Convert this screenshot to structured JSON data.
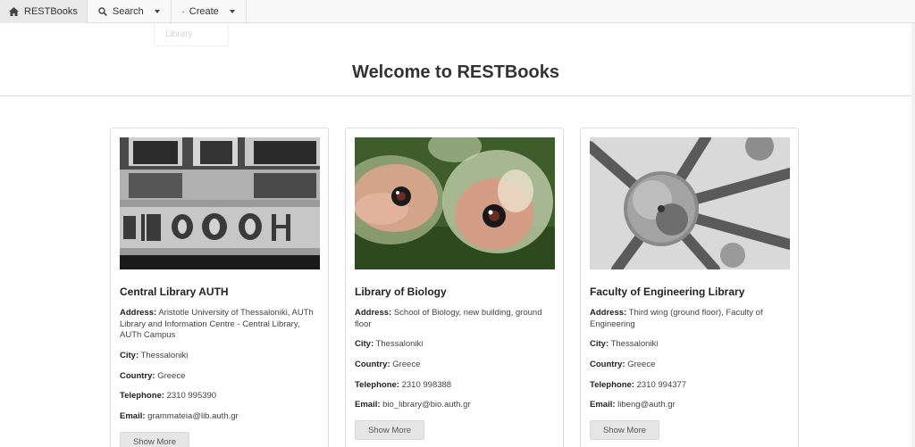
{
  "navbar": {
    "brand_label": "RESTBooks",
    "search_label": "Search",
    "create_label": "Create"
  },
  "dropdown": {
    "items": [
      "Library"
    ]
  },
  "page": {
    "title": "Welcome to RESTBooks"
  },
  "labels": {
    "address": "Address:",
    "city": "City:",
    "country": "Country:",
    "telephone": "Telephone:",
    "email": "Email:",
    "show_more": "Show More"
  },
  "cards": [
    {
      "title": "Central Library AUTH",
      "address": "Aristotle University of Thessaloniki, AUTh Library and Information Centre - Central Library, AUTh Campus",
      "city": "Thessaloniki",
      "country": "Greece",
      "telephone": "2310 995390",
      "email": "grammateia@lib.auth.gr",
      "image_icon": "building-sign-photo"
    },
    {
      "title": "Library of Biology",
      "address": "School of Biology, new building, ground floor",
      "city": "Thessaloniki",
      "country": "Greece",
      "telephone": "2310 998388",
      "email": "bio_library@bio.auth.gr",
      "image_icon": "embryo-photo"
    },
    {
      "title": "Faculty of Engineering Library",
      "address": "Third wing (ground floor), Faculty of Engineering",
      "city": "Thessaloniki",
      "country": "Greece",
      "telephone": "2310 994377",
      "email": "libeng@auth.gr",
      "image_icon": "atomium-photo"
    }
  ]
}
